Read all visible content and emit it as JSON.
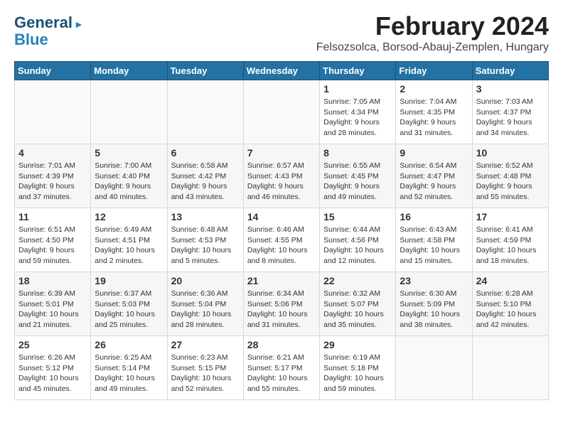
{
  "header": {
    "logo_line1": "General",
    "logo_line2": "Blue",
    "title": "February 2024",
    "subtitle": "Felsozsolca, Borsod-Abauj-Zemplen, Hungary"
  },
  "columns": [
    "Sunday",
    "Monday",
    "Tuesday",
    "Wednesday",
    "Thursday",
    "Friday",
    "Saturday"
  ],
  "weeks": [
    [
      {
        "day": "",
        "info": ""
      },
      {
        "day": "",
        "info": ""
      },
      {
        "day": "",
        "info": ""
      },
      {
        "day": "",
        "info": ""
      },
      {
        "day": "1",
        "info": "Sunrise: 7:05 AM\nSunset: 4:34 PM\nDaylight: 9 hours\nand 28 minutes."
      },
      {
        "day": "2",
        "info": "Sunrise: 7:04 AM\nSunset: 4:35 PM\nDaylight: 9 hours\nand 31 minutes."
      },
      {
        "day": "3",
        "info": "Sunrise: 7:03 AM\nSunset: 4:37 PM\nDaylight: 9 hours\nand 34 minutes."
      }
    ],
    [
      {
        "day": "4",
        "info": "Sunrise: 7:01 AM\nSunset: 4:39 PM\nDaylight: 9 hours\nand 37 minutes."
      },
      {
        "day": "5",
        "info": "Sunrise: 7:00 AM\nSunset: 4:40 PM\nDaylight: 9 hours\nand 40 minutes."
      },
      {
        "day": "6",
        "info": "Sunrise: 6:58 AM\nSunset: 4:42 PM\nDaylight: 9 hours\nand 43 minutes."
      },
      {
        "day": "7",
        "info": "Sunrise: 6:57 AM\nSunset: 4:43 PM\nDaylight: 9 hours\nand 46 minutes."
      },
      {
        "day": "8",
        "info": "Sunrise: 6:55 AM\nSunset: 4:45 PM\nDaylight: 9 hours\nand 49 minutes."
      },
      {
        "day": "9",
        "info": "Sunrise: 6:54 AM\nSunset: 4:47 PM\nDaylight: 9 hours\nand 52 minutes."
      },
      {
        "day": "10",
        "info": "Sunrise: 6:52 AM\nSunset: 4:48 PM\nDaylight: 9 hours\nand 55 minutes."
      }
    ],
    [
      {
        "day": "11",
        "info": "Sunrise: 6:51 AM\nSunset: 4:50 PM\nDaylight: 9 hours\nand 59 minutes."
      },
      {
        "day": "12",
        "info": "Sunrise: 6:49 AM\nSunset: 4:51 PM\nDaylight: 10 hours\nand 2 minutes."
      },
      {
        "day": "13",
        "info": "Sunrise: 6:48 AM\nSunset: 4:53 PM\nDaylight: 10 hours\nand 5 minutes."
      },
      {
        "day": "14",
        "info": "Sunrise: 6:46 AM\nSunset: 4:55 PM\nDaylight: 10 hours\nand 8 minutes."
      },
      {
        "day": "15",
        "info": "Sunrise: 6:44 AM\nSunset: 4:56 PM\nDaylight: 10 hours\nand 12 minutes."
      },
      {
        "day": "16",
        "info": "Sunrise: 6:43 AM\nSunset: 4:58 PM\nDaylight: 10 hours\nand 15 minutes."
      },
      {
        "day": "17",
        "info": "Sunrise: 6:41 AM\nSunset: 4:59 PM\nDaylight: 10 hours\nand 18 minutes."
      }
    ],
    [
      {
        "day": "18",
        "info": "Sunrise: 6:39 AM\nSunset: 5:01 PM\nDaylight: 10 hours\nand 21 minutes."
      },
      {
        "day": "19",
        "info": "Sunrise: 6:37 AM\nSunset: 5:03 PM\nDaylight: 10 hours\nand 25 minutes."
      },
      {
        "day": "20",
        "info": "Sunrise: 6:36 AM\nSunset: 5:04 PM\nDaylight: 10 hours\nand 28 minutes."
      },
      {
        "day": "21",
        "info": "Sunrise: 6:34 AM\nSunset: 5:06 PM\nDaylight: 10 hours\nand 31 minutes."
      },
      {
        "day": "22",
        "info": "Sunrise: 6:32 AM\nSunset: 5:07 PM\nDaylight: 10 hours\nand 35 minutes."
      },
      {
        "day": "23",
        "info": "Sunrise: 6:30 AM\nSunset: 5:09 PM\nDaylight: 10 hours\nand 38 minutes."
      },
      {
        "day": "24",
        "info": "Sunrise: 6:28 AM\nSunset: 5:10 PM\nDaylight: 10 hours\nand 42 minutes."
      }
    ],
    [
      {
        "day": "25",
        "info": "Sunrise: 6:26 AM\nSunset: 5:12 PM\nDaylight: 10 hours\nand 45 minutes."
      },
      {
        "day": "26",
        "info": "Sunrise: 6:25 AM\nSunset: 5:14 PM\nDaylight: 10 hours\nand 49 minutes."
      },
      {
        "day": "27",
        "info": "Sunrise: 6:23 AM\nSunset: 5:15 PM\nDaylight: 10 hours\nand 52 minutes."
      },
      {
        "day": "28",
        "info": "Sunrise: 6:21 AM\nSunset: 5:17 PM\nDaylight: 10 hours\nand 55 minutes."
      },
      {
        "day": "29",
        "info": "Sunrise: 6:19 AM\nSunset: 5:18 PM\nDaylight: 10 hours\nand 59 minutes."
      },
      {
        "day": "",
        "info": ""
      },
      {
        "day": "",
        "info": ""
      }
    ]
  ]
}
